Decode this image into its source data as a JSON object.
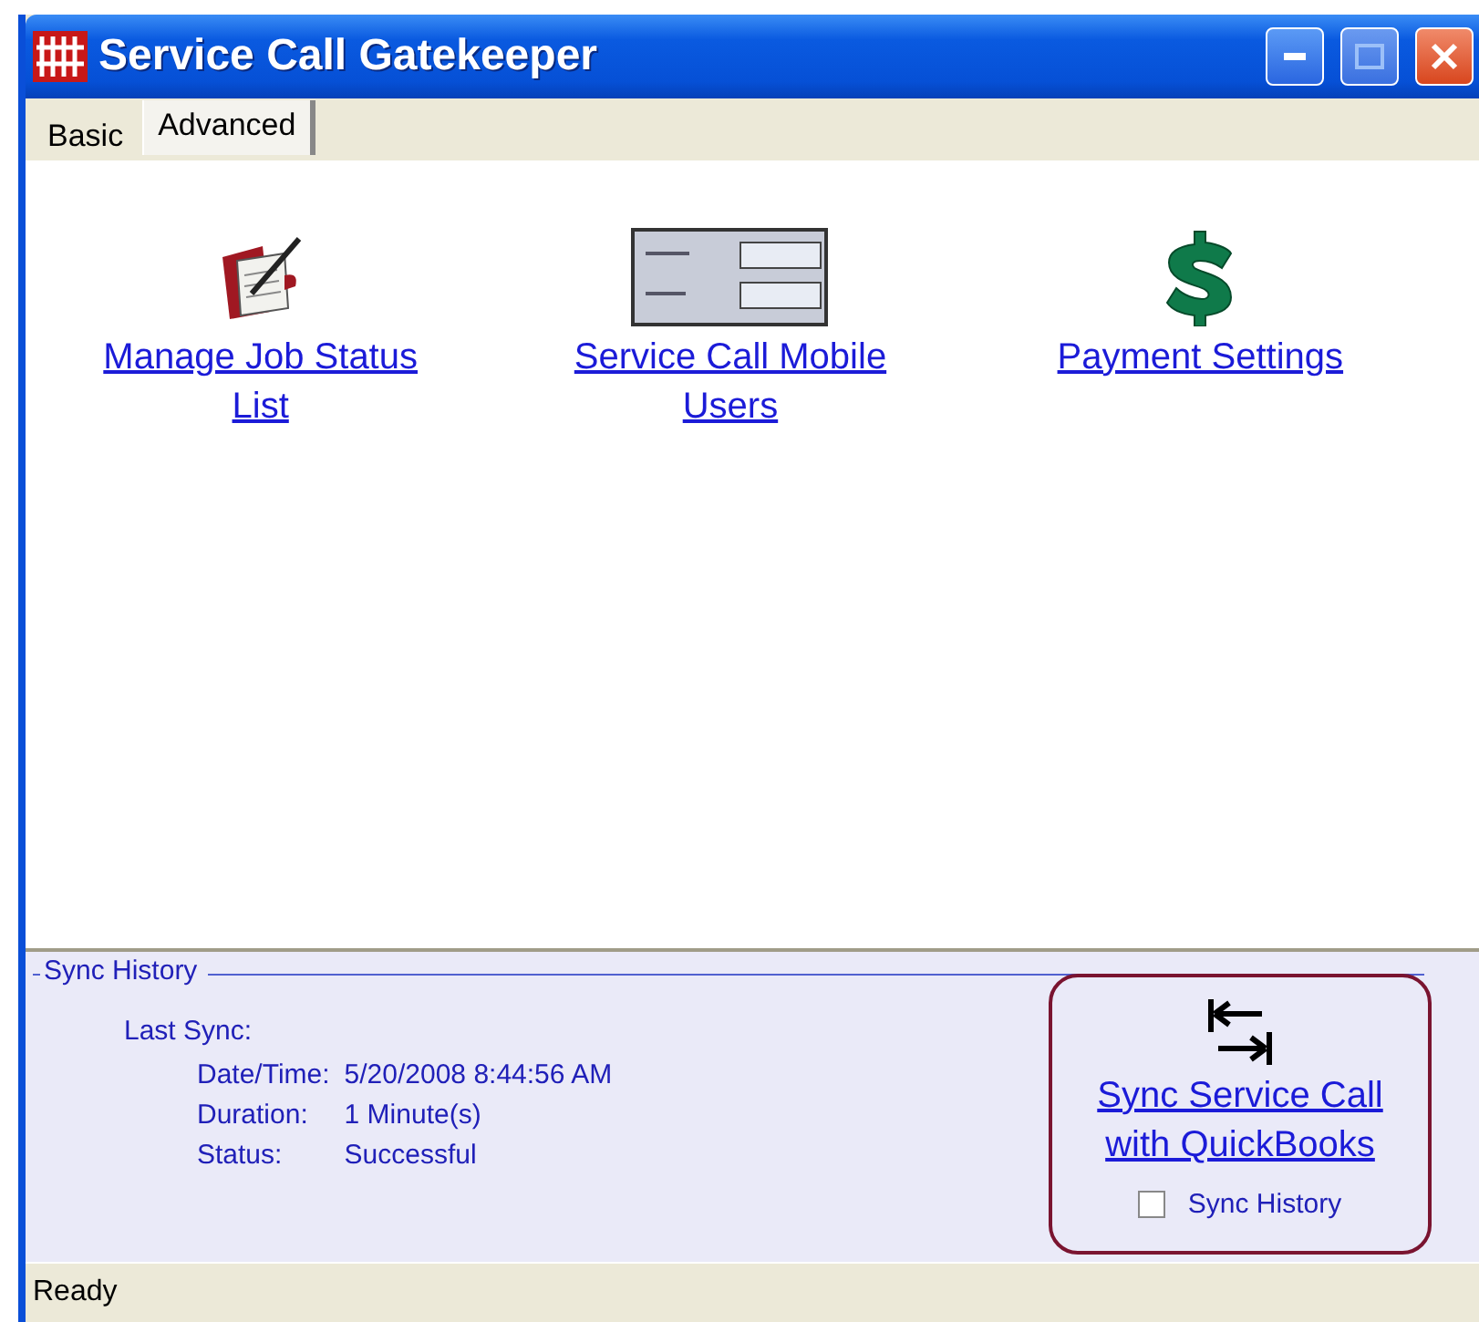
{
  "window": {
    "title": "Service Call Gatekeeper"
  },
  "tabs": [
    {
      "label": "Basic",
      "selected": false
    },
    {
      "label": "Advanced",
      "selected": true
    }
  ],
  "actions": [
    {
      "kind": "journal",
      "label": "Manage Job Status List"
    },
    {
      "kind": "login",
      "label": "Service Call Mobile Users"
    },
    {
      "kind": "dollar",
      "label": "Payment Settings"
    }
  ],
  "sync_history": {
    "title": "Sync History",
    "last_sync_label": "Last Sync:",
    "rows": [
      {
        "label": "Date/Time:",
        "value": "5/20/2008 8:44:56 AM"
      },
      {
        "label": "Duration:",
        "value": "1 Minute(s)"
      },
      {
        "label": "Status:",
        "value": "Successful"
      }
    ],
    "sync_link": "Sync Service Call with QuickBooks",
    "history_checkbox": {
      "label": "Sync History",
      "checked": false
    }
  },
  "status_bar": "Ready"
}
